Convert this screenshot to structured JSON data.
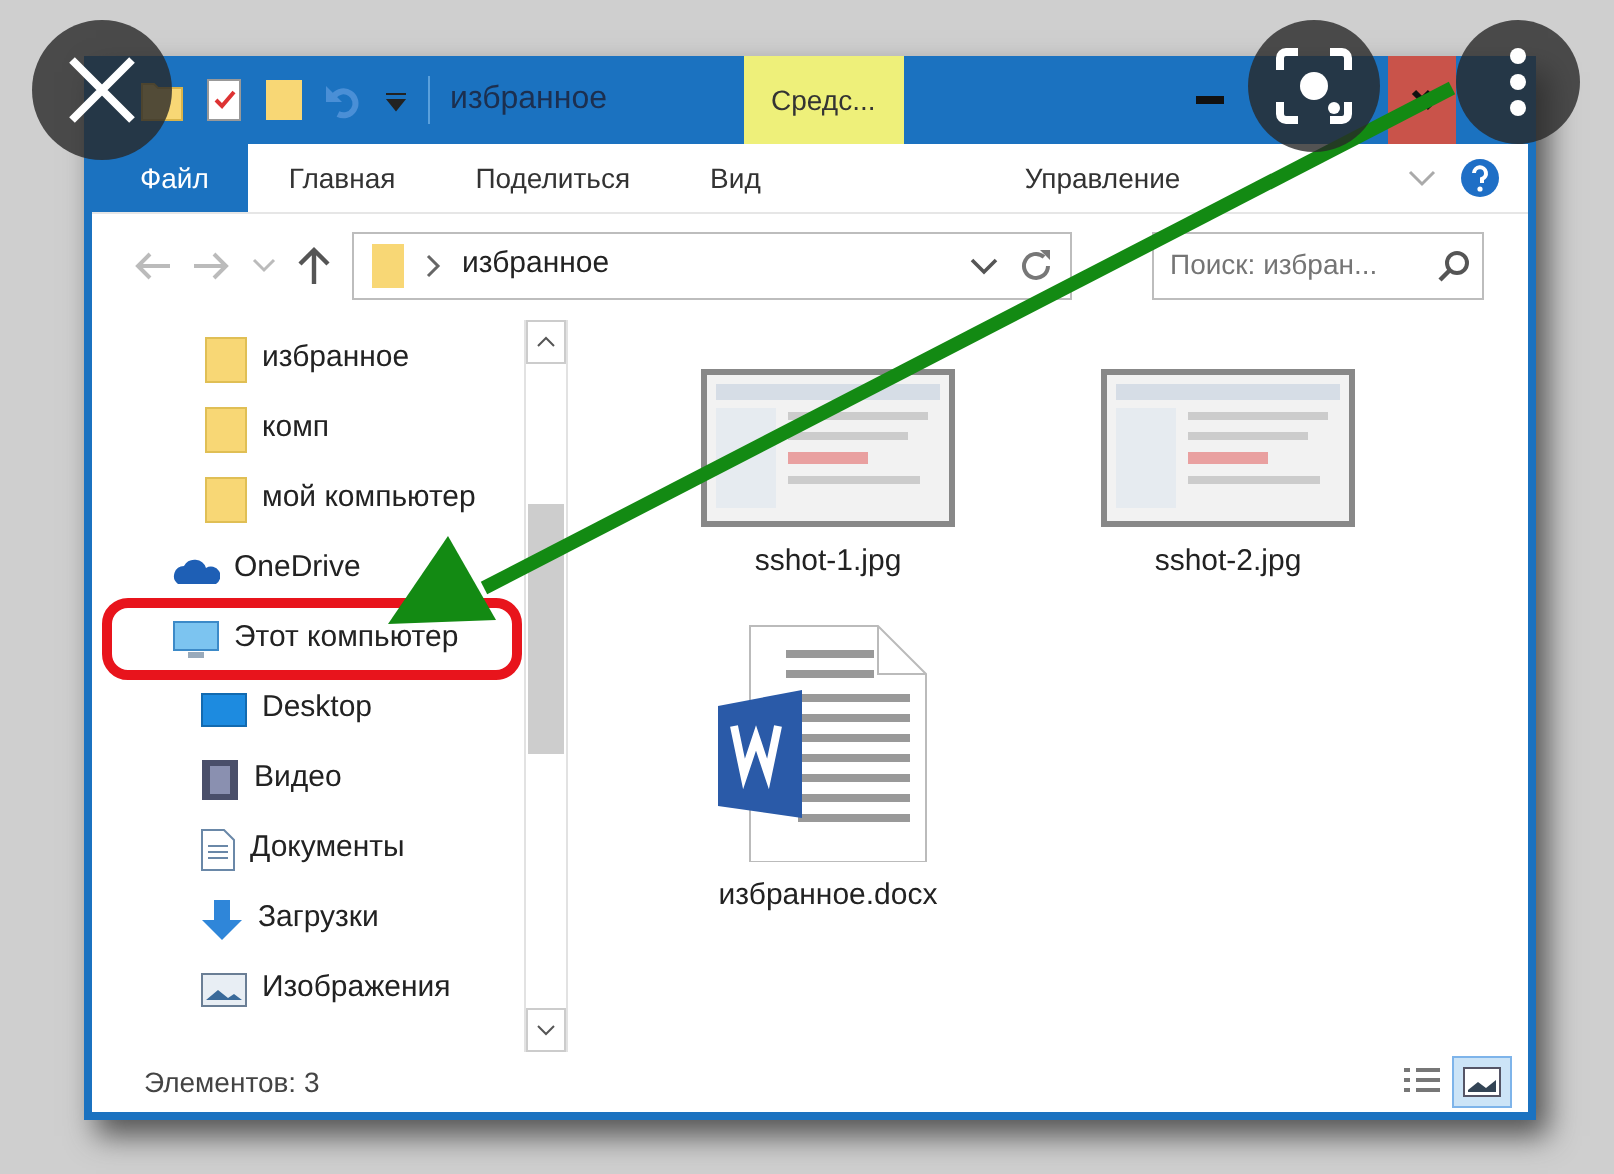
{
  "title_bar": {
    "title": "избранное",
    "context_tab": "Средс..."
  },
  "ribbon": {
    "tabs": [
      {
        "label": "Файл",
        "kind": "file"
      },
      {
        "label": "Главная",
        "kind": "normal"
      },
      {
        "label": "Поделиться",
        "kind": "normal"
      },
      {
        "label": "Вид",
        "kind": "normal"
      },
      {
        "label": "Управление",
        "kind": "contextual"
      }
    ]
  },
  "address_bar": {
    "path": "избранное"
  },
  "search": {
    "placeholder": "Поиск: избран..."
  },
  "quick_access_items": [
    {
      "label": "избранное",
      "kind": "folder"
    },
    {
      "label": "комп",
      "kind": "folder"
    },
    {
      "label": "мой компьютер",
      "kind": "folder"
    }
  ],
  "navigation": [
    {
      "label": "OneDrive",
      "kind": "cloud",
      "annotated": false
    },
    {
      "label": "Этот компьютер",
      "kind": "computer",
      "annotated": true,
      "children": [
        {
          "label": "Desktop",
          "kind": "desktop"
        },
        {
          "label": "Видео",
          "kind": "video"
        },
        {
          "label": "Документы",
          "kind": "documents"
        },
        {
          "label": "Загрузки",
          "kind": "downloads"
        },
        {
          "label": "Изображения",
          "kind": "pictures"
        }
      ]
    }
  ],
  "files": [
    {
      "name": "sshot-1.jpg",
      "kind": "image"
    },
    {
      "name": "sshot-2.jpg",
      "kind": "image"
    },
    {
      "name": "избранное.docx",
      "kind": "word"
    }
  ],
  "status_bar": {
    "count": "Элементов: 3",
    "views": [
      {
        "kind": "details",
        "selected": false
      },
      {
        "kind": "large-icons",
        "selected": true
      }
    ]
  }
}
